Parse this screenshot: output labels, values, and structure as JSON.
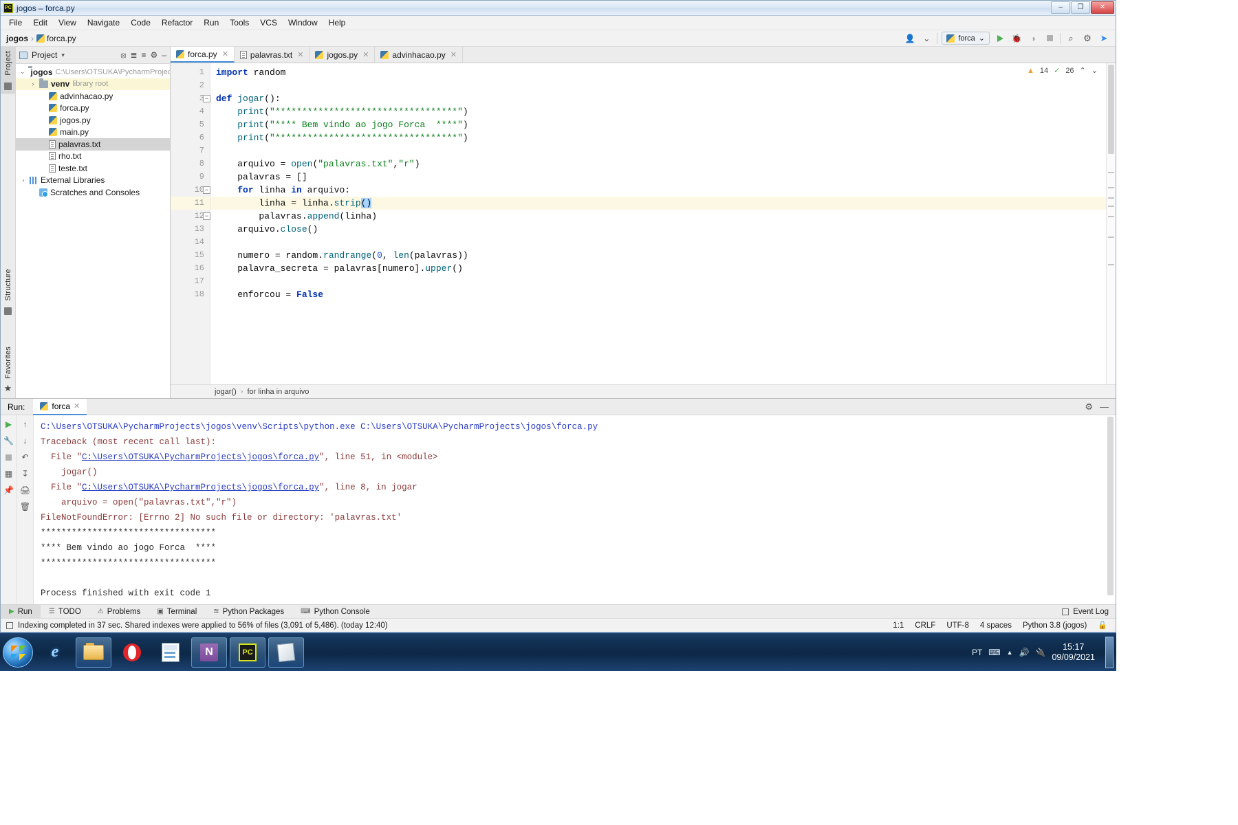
{
  "window": {
    "title": "jogos – forca.py",
    "app_icon": "pycharm-icon",
    "minimize": "–",
    "maximize": "❐",
    "close": "✕"
  },
  "menubar": {
    "items": [
      "File",
      "Edit",
      "View",
      "Navigate",
      "Code",
      "Refactor",
      "Run",
      "Tools",
      "VCS",
      "Window",
      "Help"
    ]
  },
  "breadcrumb": {
    "project": "jogos",
    "separator": "›",
    "file": "forca.py"
  },
  "toolbar": {
    "run_config": "forca",
    "run_config_icon": "python-icon",
    "chevron": "⌄",
    "user_icon": "user-icon",
    "run": "▶",
    "debug": "debug-icon",
    "coverage": "coverage-icon",
    "stop": "stop-icon",
    "search": "⌕",
    "settings": "⚙",
    "update": "update-icon"
  },
  "left_rail": {
    "project_label": "Project",
    "structure_label": "Structure",
    "favorites_label": "Favorites"
  },
  "project_panel": {
    "header": "Project",
    "header_chevron": "▾",
    "actions": [
      "locate-icon",
      "expand-icon",
      "collapse-icon",
      "gear-icon",
      "hide-icon"
    ],
    "tree": [
      {
        "label": "jogos",
        "path": "C:\\Users\\OTSUKA\\PycharmProjects",
        "icon": "folder-icon",
        "arrow": "⌄",
        "indent": 0,
        "bold": true,
        "state": "normal"
      },
      {
        "label": "venv",
        "path": "library root",
        "icon": "folder-icon",
        "arrow": "›",
        "indent": 1,
        "bold": true,
        "state": "highlight"
      },
      {
        "label": "advinhacao.py",
        "path": "",
        "icon": "python-file-icon",
        "arrow": "",
        "indent": 2,
        "bold": false,
        "state": "normal"
      },
      {
        "label": "forca.py",
        "path": "",
        "icon": "python-file-icon",
        "arrow": "",
        "indent": 2,
        "bold": false,
        "state": "normal"
      },
      {
        "label": "jogos.py",
        "path": "",
        "icon": "python-file-icon",
        "arrow": "",
        "indent": 2,
        "bold": false,
        "state": "normal"
      },
      {
        "label": "main.py",
        "path": "",
        "icon": "python-file-icon",
        "arrow": "",
        "indent": 2,
        "bold": false,
        "state": "normal"
      },
      {
        "label": "palavras.txt",
        "path": "",
        "icon": "text-file-icon",
        "arrow": "",
        "indent": 2,
        "bold": false,
        "state": "selected"
      },
      {
        "label": "rho.txt",
        "path": "",
        "icon": "text-file-icon",
        "arrow": "",
        "indent": 2,
        "bold": false,
        "state": "normal"
      },
      {
        "label": "teste.txt",
        "path": "",
        "icon": "text-file-icon",
        "arrow": "",
        "indent": 2,
        "bold": false,
        "state": "normal"
      },
      {
        "label": "External Libraries",
        "path": "",
        "icon": "library-icon",
        "arrow": "›",
        "indent": 0,
        "bold": false,
        "state": "normal"
      },
      {
        "label": "Scratches and Consoles",
        "path": "",
        "icon": "scratch-icon",
        "arrow": "",
        "indent": 1,
        "bold": false,
        "state": "normal"
      }
    ]
  },
  "editor": {
    "tabs": [
      {
        "label": "forca.py",
        "icon": "python-file-icon",
        "active": true,
        "close": "✕"
      },
      {
        "label": "palavras.txt",
        "icon": "text-file-icon",
        "active": false,
        "close": "✕"
      },
      {
        "label": "jogos.py",
        "icon": "python-file-icon",
        "active": false,
        "close": "✕"
      },
      {
        "label": "advinhacao.py",
        "icon": "python-file-icon",
        "active": false,
        "close": "✕"
      }
    ],
    "inspection": {
      "warning_icon": "warning-triangle-icon",
      "warning_count": "14",
      "ok_icon": "checkmark-icon",
      "ok_count": "26",
      "up_arrow": "⌃",
      "down_arrow": "⌄"
    },
    "lines": [
      {
        "n": "1",
        "text": "import random",
        "current": false
      },
      {
        "n": "2",
        "text": "",
        "current": false
      },
      {
        "n": "3",
        "text": "def jogar():",
        "current": false
      },
      {
        "n": "4",
        "text": "    print(\"**********************************\")",
        "current": false
      },
      {
        "n": "5",
        "text": "    print(\"**** Bem vindo ao jogo Forca  ****\")",
        "current": false
      },
      {
        "n": "6",
        "text": "    print(\"**********************************\")",
        "current": false
      },
      {
        "n": "7",
        "text": "",
        "current": false
      },
      {
        "n": "8",
        "text": "    arquivo = open(\"palavras.txt\",\"r\")",
        "current": false
      },
      {
        "n": "9",
        "text": "    palavras = []",
        "current": false
      },
      {
        "n": "10",
        "text": "    for linha in arquivo:",
        "current": false
      },
      {
        "n": "11",
        "text": "        linha = linha.strip()",
        "current": true
      },
      {
        "n": "12",
        "text": "        palavras.append(linha)",
        "current": false
      },
      {
        "n": "13",
        "text": "    arquivo.close()",
        "current": false
      },
      {
        "n": "14",
        "text": "",
        "current": false
      },
      {
        "n": "15",
        "text": "    numero = random.randrange(0, len(palavras))",
        "current": false
      },
      {
        "n": "16",
        "text": "    palavra_secreta = palavras[numero].upper()",
        "current": false
      },
      {
        "n": "17",
        "text": "",
        "current": false
      },
      {
        "n": "18",
        "text": "    enforcou = False",
        "current": false
      }
    ],
    "crumb": {
      "func": "jogar()",
      "sep": "›",
      "context": "for linha in arquivo"
    }
  },
  "run_panel": {
    "label": "Run:",
    "tab_label": "forca",
    "tab_icon": "python-icon",
    "tab_close": "✕",
    "settings_icon": "⚙",
    "hide_icon": "—",
    "tools_left": [
      "rerun-icon",
      "wrench-icon",
      "stop-icon",
      "layout-icon",
      "pin-icon"
    ],
    "tools_right": [
      "up-arrow-icon",
      "down-arrow-icon",
      "soft-wrap-icon",
      "scroll-end-icon",
      "print-icon",
      "trash-icon"
    ],
    "console": [
      {
        "text": "C:\\Users\\OTSUKA\\PycharmProjects\\jogos\\venv\\Scripts\\python.exe C:\\Users\\OTSUKA\\PycharmProjects\\jogos\\forca.py",
        "type": "link-plain"
      },
      {
        "text": "Traceback (most recent call last):",
        "type": "err"
      },
      {
        "text": "  File \"C:\\Users\\OTSUKA\\PycharmProjects\\jogos\\forca.py\", line 51, in <module>",
        "type": "err-link",
        "link": "C:\\Users\\OTSUKA\\PycharmProjects\\jogos\\forca.py",
        "prefix": "  File \"",
        "suffix": "\", line 51, in <module>"
      },
      {
        "text": "    jogar()",
        "type": "err"
      },
      {
        "text": "  File \"C:\\Users\\OTSUKA\\PycharmProjects\\jogos\\forca.py\", line 8, in jogar",
        "type": "err-link",
        "link": "C:\\Users\\OTSUKA\\PycharmProjects\\jogos\\forca.py",
        "prefix": "  File \"",
        "suffix": "\", line 8, in jogar"
      },
      {
        "text": "    arquivo = open(\"palavras.txt\",\"r\")",
        "type": "err"
      },
      {
        "text": "FileNotFoundError: [Errno 2] No such file or directory: 'palavras.txt'",
        "type": "err"
      },
      {
        "text": "**********************************",
        "type": "plain"
      },
      {
        "text": "**** Bem vindo ao jogo Forca  ****",
        "type": "plain"
      },
      {
        "text": "**********************************",
        "type": "plain"
      },
      {
        "text": "",
        "type": "plain"
      },
      {
        "text": "Process finished with exit code 1",
        "type": "plain"
      }
    ]
  },
  "bottom_toolbar": {
    "items": [
      {
        "label": "Run",
        "icon": "run-icon",
        "active": true
      },
      {
        "label": "TODO",
        "icon": "todo-icon",
        "active": false
      },
      {
        "label": "Problems",
        "icon": "problems-icon",
        "active": false
      },
      {
        "label": "Terminal",
        "icon": "terminal-icon",
        "active": false
      },
      {
        "label": "Python Packages",
        "icon": "packages-icon",
        "active": false
      },
      {
        "label": "Python Console",
        "icon": "console-icon",
        "active": false
      }
    ],
    "event_log": {
      "label": "Event Log",
      "icon": "event-log-icon"
    }
  },
  "status_bar": {
    "message": "Indexing completed in 37 sec. Shared indexes were applied to 56% of files (3,091 of 5,486). (today 12:40)",
    "message_icon": "indexing-icon",
    "caret": "1:1",
    "line_sep": "CRLF",
    "encoding": "UTF-8",
    "indent": "4 spaces",
    "interpreter": "Python 3.8 (jogos)",
    "lock": "lock-icon"
  },
  "taskbar": {
    "start": "start-orb",
    "items": [
      {
        "icon": "internet-explorer-icon",
        "pinned": true
      },
      {
        "icon": "file-explorer-icon",
        "pinned": true
      },
      {
        "icon": "opera-icon",
        "pinned": true
      },
      {
        "icon": "excel-icon",
        "pinned": false
      },
      {
        "icon": "onenote-icon",
        "pinned": true
      },
      {
        "icon": "pycharm-icon",
        "pinned": true
      },
      {
        "icon": "notepad-icon",
        "pinned": true
      }
    ],
    "tray": {
      "language": "PT",
      "keyboard_icon": "keyboard-icon",
      "show_hidden": "▲",
      "volume_icon": "volume-icon",
      "power_icon": "power-icon"
    },
    "clock": {
      "time": "15:17",
      "date": "09/09/2021"
    }
  },
  "colors": {
    "accent": "#4a90d9",
    "keyword": "#0033b3",
    "string": "#067d17",
    "error": "#8b3a3a",
    "link": "#2a3cc4",
    "current_line": "#fcf8e3"
  }
}
